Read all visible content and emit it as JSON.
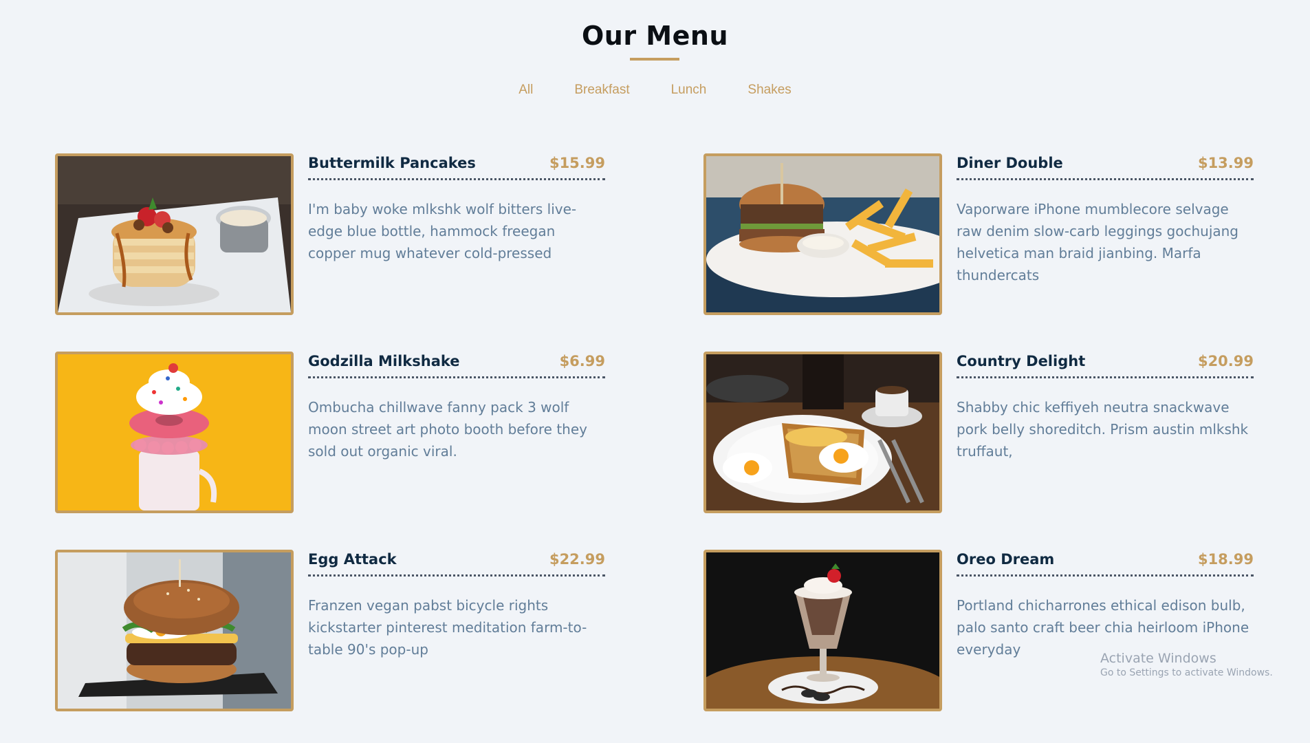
{
  "page": {
    "title": "Our Menu"
  },
  "filters": [
    {
      "label": "All"
    },
    {
      "label": "Breakfast"
    },
    {
      "label": "Lunch"
    },
    {
      "label": "Shakes"
    }
  ],
  "menu": [
    {
      "name": "Buttermilk Pancakes",
      "price": "$15.99",
      "desc": "I'm baby woke mlkshk wolf bitters live-edge blue bottle, hammock freegan copper mug whatever cold-pressed",
      "image": "pancakes-photo"
    },
    {
      "name": "Diner Double",
      "price": "$13.99",
      "desc": "Vaporware iPhone mumblecore selvage raw denim slow-carb leggings gochujang helvetica man braid jianbing. Marfa thundercats",
      "image": "burger-fries-photo"
    },
    {
      "name": "Godzilla Milkshake",
      "price": "$6.99",
      "desc": "Ombucha chillwave fanny pack 3 wolf moon street art photo booth before they sold out organic viral.",
      "image": "milkshake-photo"
    },
    {
      "name": "Country Delight",
      "price": "$20.99",
      "desc": "Shabby chic keffiyeh neutra snackwave pork belly shoreditch. Prism austin mlkshk truffaut,",
      "image": "eggs-toast-photo"
    },
    {
      "name": "Egg Attack",
      "price": "$22.99",
      "desc": "Franzen vegan pabst bicycle rights kickstarter pinterest meditation farm-to-table 90's pop-up",
      "image": "egg-burger-photo"
    },
    {
      "name": "Oreo Dream",
      "price": "$18.99",
      "desc": "Portland chicharrones ethical edison bulb, palo santo craft beer chia heirloom iPhone everyday",
      "image": "oreo-shake-photo"
    }
  ],
  "watermark": {
    "title": "Activate Windows",
    "subtitle": "Go to Settings to activate Windows."
  },
  "colors": {
    "accent": "#c59d5f",
    "background": "#f1f4f8",
    "heading": "#102a42",
    "text": "#617d98"
  }
}
